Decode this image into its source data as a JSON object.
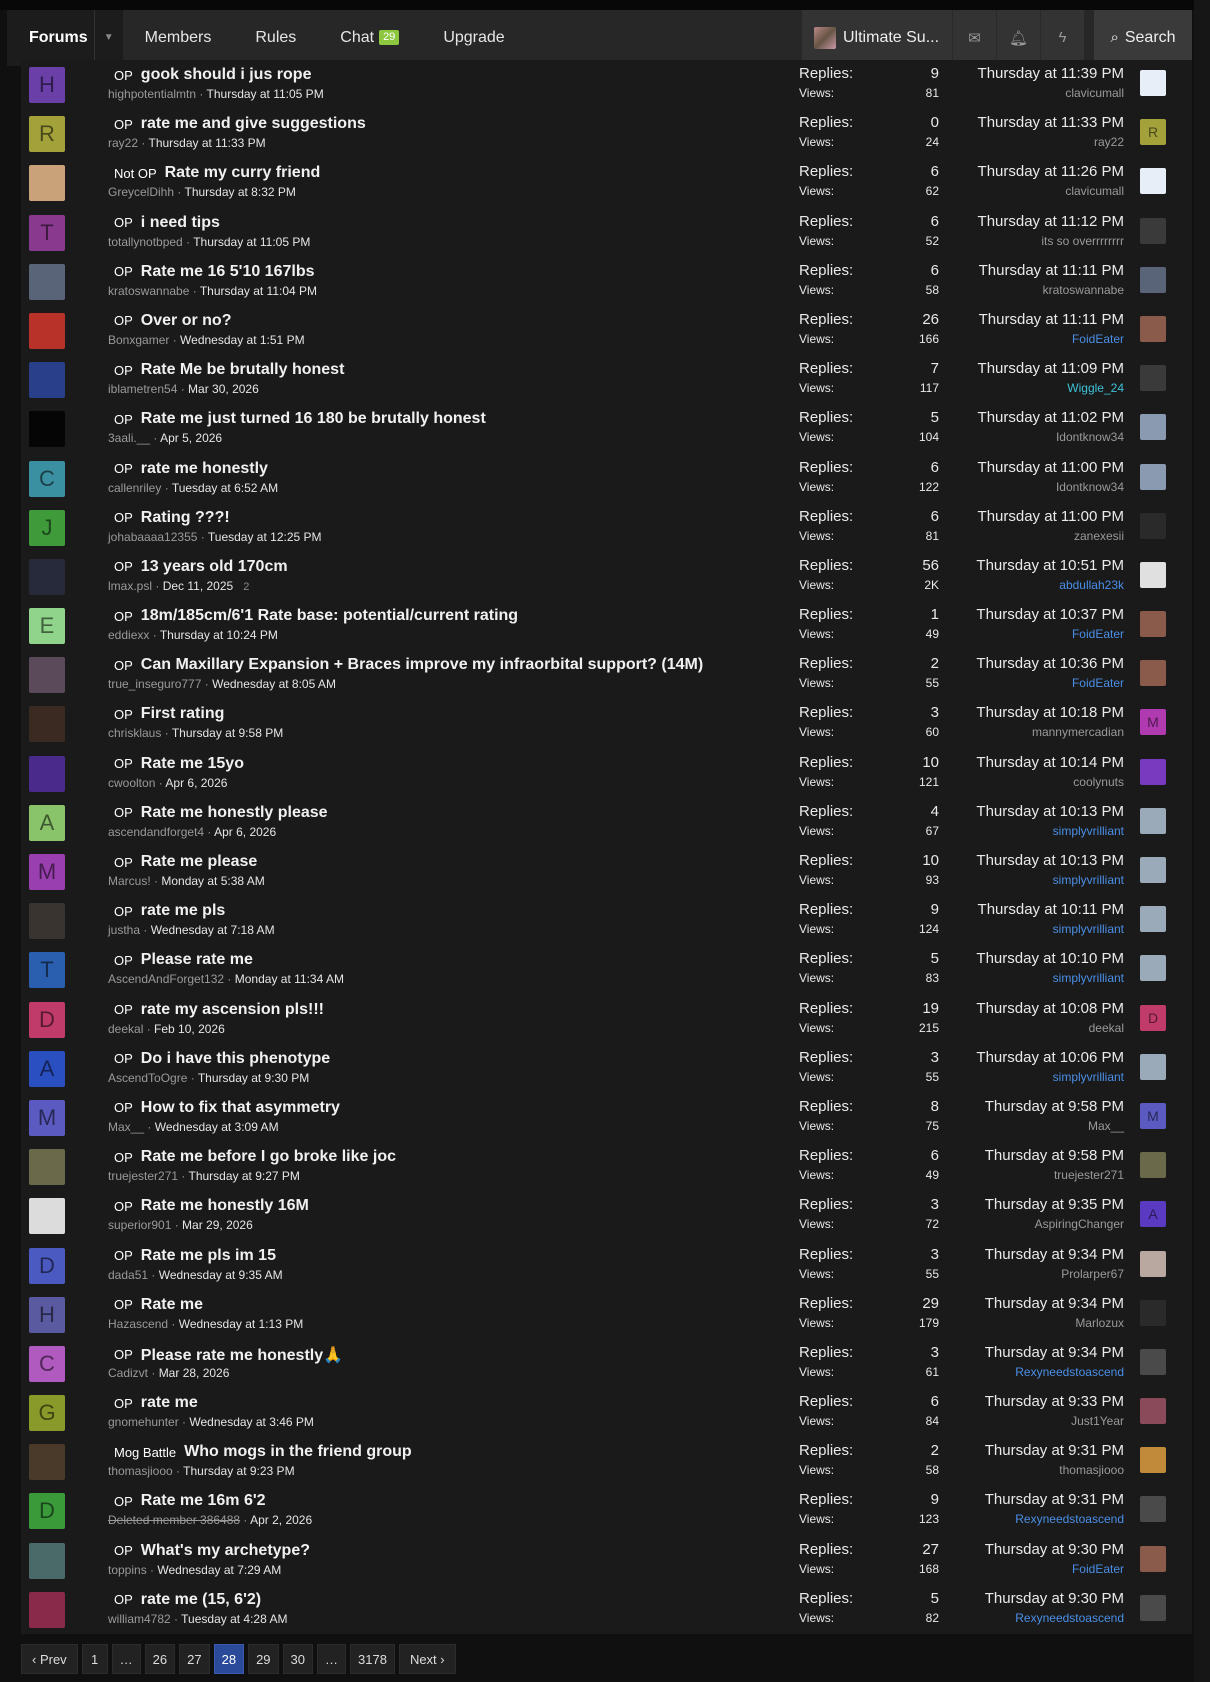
{
  "nav": {
    "forums": "Forums",
    "members": "Members",
    "rules": "Rules",
    "chat": "Chat",
    "chat_count": "29",
    "upgrade": "Upgrade",
    "account": "Ultimate Su...",
    "search": "Search"
  },
  "labels": {
    "replies": "Replies:",
    "views": "Views:"
  },
  "threads": [
    {
      "prefix": "OP",
      "title": "gook should i jus rope",
      "author": "highpotentialmtn",
      "date": "Thursday at 11:05 PM",
      "replies": "9",
      "views": "81",
      "last_time": "Thursday at 11:39 PM",
      "last_user": "clavicumall",
      "av_letter": "H",
      "av_color": "#6a3fa8"
    },
    {
      "prefix": "OP",
      "title": "rate me and give suggestions",
      "author": "ray22",
      "date": "Thursday at 11:33 PM",
      "replies": "0",
      "views": "24",
      "last_time": "Thursday at 11:33 PM",
      "last_user": "ray22",
      "av_letter": "R",
      "av_color": "#a3a13a"
    },
    {
      "prefix": "Not OP",
      "title": "Rate my curry friend",
      "author": "GreycelDihh",
      "date": "Thursday at 8:32 PM",
      "replies": "6",
      "views": "62",
      "last_time": "Thursday at 11:26 PM",
      "last_user": "clavicumall",
      "av_letter": "",
      "av_color": "#c9a27a"
    },
    {
      "prefix": "OP",
      "title": "i need tips",
      "author": "totallynotbped",
      "date": "Thursday at 11:05 PM",
      "replies": "6",
      "views": "52",
      "last_time": "Thursday at 11:12 PM",
      "last_user": "its so overrrrrrrr",
      "av_letter": "T",
      "av_color": "#8a3a8e"
    },
    {
      "prefix": "OP",
      "title": "Rate me 16 5'10 167lbs",
      "author": "kratoswannabe",
      "date": "Thursday at 11:04 PM",
      "replies": "6",
      "views": "58",
      "last_time": "Thursday at 11:11 PM",
      "last_user": "kratoswannabe",
      "av_letter": "",
      "av_color": "#5a6478"
    },
    {
      "prefix": "OP",
      "title": "Over or no?",
      "author": "Bonxgamer",
      "date": "Wednesday at 1:51 PM",
      "replies": "26",
      "views": "166",
      "last_time": "Thursday at 11:11 PM",
      "last_user": "FoidEater",
      "av_letter": "",
      "av_color": "#b8322a"
    },
    {
      "prefix": "OP",
      "title": "Rate Me be brutally honest",
      "author": "iblametren54",
      "date": "Mar 30, 2026",
      "replies": "7",
      "views": "117",
      "last_time": "Thursday at 11:09 PM",
      "last_user": "Wiggle_24",
      "av_letter": "",
      "av_color": "#2a3f8a"
    },
    {
      "prefix": "OP",
      "title": "Rate me just turned 16 180 be brutally honest",
      "author": "3aali.__",
      "date": "Apr 5, 2026",
      "replies": "5",
      "views": "104",
      "last_time": "Thursday at 11:02 PM",
      "last_user": "Idontknow34",
      "av_letter": "",
      "av_color": "#050505"
    },
    {
      "prefix": "OP",
      "title": "rate me honestly",
      "author": "callenriley",
      "date": "Tuesday at 6:52 AM",
      "replies": "6",
      "views": "122",
      "last_time": "Thursday at 11:00 PM",
      "last_user": "Idontknow34",
      "av_letter": "C",
      "av_color": "#3a8fa0"
    },
    {
      "prefix": "OP",
      "title": "Rating ???!",
      "author": "johabaaaa12355",
      "date": "Tuesday at 12:25 PM",
      "replies": "6",
      "views": "81",
      "last_time": "Thursday at 11:00 PM",
      "last_user": "zanexesii",
      "av_letter": "J",
      "av_color": "#3f9a3a"
    },
    {
      "prefix": "OP",
      "title": "13 years old 170cm",
      "author": "lmax.psl",
      "date": "Dec 11, 2025",
      "pages": "2",
      "replies": "56",
      "views": "2K",
      "last_time": "Thursday at 10:51 PM",
      "last_user": "abdullah23k",
      "av_letter": "",
      "av_color": "#262a3a"
    },
    {
      "prefix": "OP",
      "title": "18m/185cm/6'1 Rate base: potential/current rating",
      "author": "eddiexx",
      "date": "Thursday at 10:24 PM",
      "replies": "1",
      "views": "49",
      "last_time": "Thursday at 10:37 PM",
      "last_user": "FoidEater",
      "av_letter": "E",
      "av_color": "#8fd48a"
    },
    {
      "prefix": "OP",
      "title": "Can Maxillary Expansion + Braces improve my infraorbital support? (14M)",
      "author": "true_inseguro777",
      "date": "Wednesday at 8:05 AM",
      "replies": "2",
      "views": "55",
      "last_time": "Thursday at 10:36 PM",
      "last_user": "FoidEater",
      "av_letter": "",
      "av_color": "#5a4a5a"
    },
    {
      "prefix": "OP",
      "title": "First rating",
      "author": "chrisklaus",
      "date": "Thursday at 9:58 PM",
      "replies": "3",
      "views": "60",
      "last_time": "Thursday at 10:18 PM",
      "last_user": "mannymercadian",
      "av_letter": "",
      "av_color": "#3a2a22"
    },
    {
      "prefix": "OP",
      "title": "Rate me 15yo",
      "author": "cwoolton",
      "date": "Apr 6, 2026",
      "replies": "10",
      "views": "121",
      "last_time": "Thursday at 10:14 PM",
      "last_user": "coolynuts",
      "av_letter": "",
      "av_color": "#4a2a8a"
    },
    {
      "prefix": "OP",
      "title": "Rate me honestly please",
      "author": "ascendandforget4",
      "date": "Apr 6, 2026",
      "replies": "4",
      "views": "67",
      "last_time": "Thursday at 10:13 PM",
      "last_user": "simplyvrilliant",
      "av_letter": "A",
      "av_color": "#8ac46a"
    },
    {
      "prefix": "OP",
      "title": "Rate me please",
      "author": "Marcus!",
      "date": "Monday at 5:38 AM",
      "replies": "10",
      "views": "93",
      "last_time": "Thursday at 10:13 PM",
      "last_user": "simplyvrilliant",
      "av_letter": "M",
      "av_color": "#9a3fb0"
    },
    {
      "prefix": "OP",
      "title": "rate me pls",
      "author": "justha",
      "date": "Wednesday at 7:18 AM",
      "replies": "9",
      "views": "124",
      "last_time": "Thursday at 10:11 PM",
      "last_user": "simplyvrilliant",
      "av_letter": "",
      "av_color": "#3a3430"
    },
    {
      "prefix": "OP",
      "title": "Please rate me",
      "author": "AscendAndForget132",
      "date": "Monday at 11:34 AM",
      "replies": "5",
      "views": "83",
      "last_time": "Thursday at 10:10 PM",
      "last_user": "simplyvrilliant",
      "av_letter": "T",
      "av_color": "#2a5fb0"
    },
    {
      "prefix": "OP",
      "title": "rate my ascension pls!!!",
      "author": "deekal",
      "date": "Feb 10, 2026",
      "replies": "19",
      "views": "215",
      "last_time": "Thursday at 10:08 PM",
      "last_user": "deekal",
      "av_letter": "D",
      "av_color": "#c03a6a"
    },
    {
      "prefix": "OP",
      "title": "Do i have this phenotype",
      "author": "AscendToOgre",
      "date": "Thursday at 9:30 PM",
      "replies": "3",
      "views": "55",
      "last_time": "Thursday at 10:06 PM",
      "last_user": "simplyvrilliant",
      "av_letter": "A",
      "av_color": "#2a4fc0"
    },
    {
      "prefix": "OP",
      "title": "How to fix that asymmetry",
      "author": "Max__",
      "date": "Wednesday at 3:09 AM",
      "replies": "8",
      "views": "75",
      "last_time": "Thursday at 9:58 PM",
      "last_user": "Max__",
      "av_letter": "M",
      "av_color": "#5a5ac0"
    },
    {
      "prefix": "OP",
      "title": "Rate me before I go broke like joc",
      "author": "truejester271",
      "date": "Thursday at 9:27 PM",
      "replies": "6",
      "views": "49",
      "last_time": "Thursday at 9:58 PM",
      "last_user": "truejester271",
      "av_letter": "",
      "av_color": "#6a6a4a"
    },
    {
      "prefix": "OP",
      "title": "Rate me honestly 16M",
      "author": "superior901",
      "date": "Mar 29, 2026",
      "replies": "3",
      "views": "72",
      "last_time": "Thursday at 9:35 PM",
      "last_user": "AspiringChanger",
      "av_letter": "",
      "av_color": "#dcdcdc"
    },
    {
      "prefix": "OP",
      "title": "Rate me pls im 15",
      "author": "dada51",
      "date": "Wednesday at 9:35 AM",
      "replies": "3",
      "views": "55",
      "last_time": "Thursday at 9:34 PM",
      "last_user": "Prolarper67",
      "av_letter": "D",
      "av_color": "#4a5ac0"
    },
    {
      "prefix": "OP",
      "title": "Rate me",
      "author": "Hazascend",
      "date": "Wednesday at 1:13 PM",
      "replies": "29",
      "views": "179",
      "last_time": "Thursday at 9:34 PM",
      "last_user": "Marlozux",
      "av_letter": "H",
      "av_color": "#5a5aa0"
    },
    {
      "prefix": "OP",
      "title": "Please rate me honestly🙏",
      "author": "Cadizvt",
      "date": "Mar 28, 2026",
      "replies": "3",
      "views": "61",
      "last_time": "Thursday at 9:34 PM",
      "last_user": "Rexyneedstoascend",
      "av_letter": "C",
      "av_color": "#b05ac0"
    },
    {
      "prefix": "OP",
      "title": "rate me",
      "author": "gnomehunter",
      "date": "Wednesday at 3:46 PM",
      "replies": "6",
      "views": "84",
      "last_time": "Thursday at 9:33 PM",
      "last_user": "Just1Year",
      "av_letter": "G",
      "av_color": "#8a9a2a"
    },
    {
      "prefix": "Mog Battle",
      "title": "Who mogs in the friend group",
      "author": "thomasjiooo",
      "date": "Thursday at 9:23 PM",
      "replies": "2",
      "views": "58",
      "last_time": "Thursday at 9:31 PM",
      "last_user": "thomasjiooo",
      "av_letter": "",
      "av_color": "#4a3a2a"
    },
    {
      "prefix": "OP",
      "title": "Rate me 16m 6'2",
      "author": "Deleted member 386488",
      "deleted": true,
      "date": "Apr 2, 2026",
      "replies": "9",
      "views": "123",
      "last_time": "Thursday at 9:31 PM",
      "last_user": "Rexyneedstoascend",
      "av_letter": "D",
      "av_color": "#3a9a3a"
    },
    {
      "prefix": "OP",
      "title": "What's my archetype?",
      "author": "toppins",
      "date": "Wednesday at 7:29 AM",
      "replies": "27",
      "views": "168",
      "last_time": "Thursday at 9:30 PM",
      "last_user": "FoidEater",
      "av_letter": "",
      "av_color": "#4a6a6a"
    },
    {
      "prefix": "OP",
      "title": "rate me (15, 6'2)",
      "author": "william4782",
      "date": "Tuesday at 4:28 AM",
      "replies": "5",
      "views": "82",
      "last_time": "Thursday at 9:30 PM",
      "last_user": "Rexyneedstoascend",
      "av_letter": "",
      "av_color": "#8a2a4a"
    }
  ],
  "last_avatars": [
    {
      "letter": "",
      "color": "#e8eef8"
    },
    {
      "letter": "R",
      "color": "#a3a13a"
    },
    {
      "letter": "",
      "color": "#e8eef8"
    },
    {
      "letter": "",
      "color": "#3a3a3a"
    },
    {
      "letter": "",
      "color": "#5a6478"
    },
    {
      "letter": "",
      "color": "#8a5a4a"
    },
    {
      "letter": "",
      "color": "#3a3a3a"
    },
    {
      "letter": "",
      "color": "#8a9ab0"
    },
    {
      "letter": "",
      "color": "#8a9ab0"
    },
    {
      "letter": "",
      "color": "#2a2a2a"
    },
    {
      "letter": "",
      "color": "#e0e0e0"
    },
    {
      "letter": "",
      "color": "#8a5a4a"
    },
    {
      "letter": "",
      "color": "#8a5a4a"
    },
    {
      "letter": "M",
      "color": "#b03ab0"
    },
    {
      "letter": "",
      "color": "#7a3ac0"
    },
    {
      "letter": "",
      "color": "#9aaab8"
    },
    {
      "letter": "",
      "color": "#9aaab8"
    },
    {
      "letter": "",
      "color": "#9aaab8"
    },
    {
      "letter": "",
      "color": "#9aaab8"
    },
    {
      "letter": "D",
      "color": "#c03a6a"
    },
    {
      "letter": "",
      "color": "#9aaab8"
    },
    {
      "letter": "M",
      "color": "#5a5ac0"
    },
    {
      "letter": "",
      "color": "#6a6a4a"
    },
    {
      "letter": "A",
      "color": "#5a3ac0"
    },
    {
      "letter": "",
      "color": "#b8a8a0"
    },
    {
      "letter": "",
      "color": "#2a2a2a"
    },
    {
      "letter": "",
      "color": "#4a4a4a"
    },
    {
      "letter": "",
      "color": "#8a4a5a"
    },
    {
      "letter": "",
      "color": "#c08a3a"
    },
    {
      "letter": "",
      "color": "#4a4a4a"
    },
    {
      "letter": "",
      "color": "#8a5a4a"
    },
    {
      "letter": "",
      "color": "#4a4a4a"
    }
  ],
  "pager": {
    "prev": "Prev",
    "next": "Next",
    "pages": [
      "1",
      "…",
      "26",
      "27",
      "28",
      "29",
      "30",
      "…",
      "3178"
    ],
    "current": "28"
  }
}
